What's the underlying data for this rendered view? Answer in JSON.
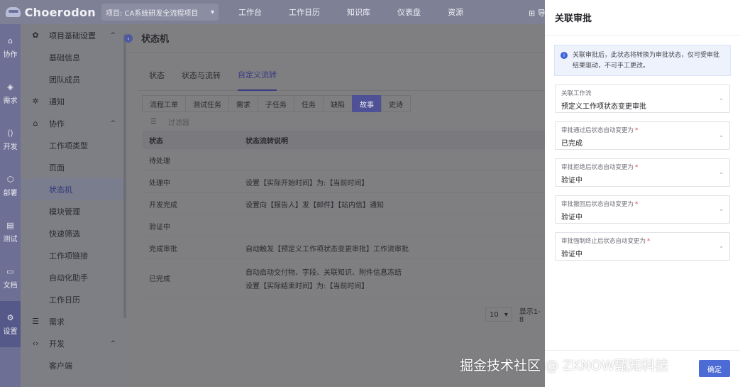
{
  "app": {
    "logo_text": "Choerodon"
  },
  "project": {
    "label": "项目: CA系统研发全流程项目",
    "chevron_icon": "chevron-down-icon"
  },
  "top_nav": [
    "工作台",
    "工作日历",
    "知识库",
    "仪表盘",
    "资源"
  ],
  "top_right_text": "⊞ 导",
  "rail": [
    {
      "label": "协作",
      "icon": "collab-icon",
      "glyph": "⌂"
    },
    {
      "label": "需求",
      "icon": "requirement-icon",
      "glyph": "◈"
    },
    {
      "label": "开发",
      "icon": "code-icon",
      "glyph": "⟨⟩"
    },
    {
      "label": "部署",
      "icon": "deploy-icon",
      "glyph": "⬡"
    },
    {
      "label": "测试",
      "icon": "test-icon",
      "glyph": "▤"
    },
    {
      "label": "文档",
      "icon": "doc-icon",
      "glyph": "▭"
    },
    {
      "label": "设置",
      "icon": "settings-icon",
      "glyph": "⚙"
    }
  ],
  "menu": {
    "group_basic": "项目基础设置",
    "basic_items": [
      "基础信息",
      "团队成员"
    ],
    "group_notify": "通知",
    "group_collab": "协作",
    "collab_items": [
      "工作项类型",
      "页面",
      "状态机",
      "模块管理",
      "快速筛选",
      "工作项链接",
      "自动化助手",
      "工作日历"
    ],
    "group_req": "需求",
    "group_dev": "开发",
    "dev_items": [
      "客户端"
    ]
  },
  "page": {
    "title": "状态机"
  },
  "tabs": [
    "状态",
    "状态与流转",
    "自定义流转"
  ],
  "chips": [
    "流程工单",
    "测试任务",
    "需求",
    "子任务",
    "任务",
    "缺陷",
    "故事",
    "史诗"
  ],
  "filter": {
    "placeholder": "过滤器"
  },
  "table": {
    "headers": [
      "状态",
      "状态流转说明"
    ],
    "rows": [
      {
        "status": "待处理",
        "desc": []
      },
      {
        "status": "处理中",
        "desc": [
          "设置【实际开始时间】为:【当前时间】"
        ]
      },
      {
        "status": "开发完成",
        "desc": [
          "设置向【报告人】发【邮件】【站内信】通知"
        ]
      },
      {
        "status": "验证中",
        "desc": []
      },
      {
        "status": "完成审批",
        "desc": [
          "自动触发【预定义工作项状态变更审批】工作流审批"
        ]
      },
      {
        "status": "已完成",
        "desc": [
          "自动启动交付物、字段、关联知识、附件信息冻结",
          "设置【实际结束时间】为:【当前时间】"
        ]
      }
    ]
  },
  "pager": {
    "size": "10",
    "text": "显示1-8"
  },
  "drawer": {
    "title": "关联审批",
    "notice": "关联审批后，此状态将转换为审批状态，仅可受审批结果驱动，不可手工更改。",
    "fields": [
      {
        "label": "关联工作流",
        "required": "",
        "value": "预定义工作项状态变更审批"
      },
      {
        "label": "审批通过后状态自动变更为",
        "required": "*",
        "value": "已完成"
      },
      {
        "label": "审批拒绝后状态自动变更为",
        "required": "*",
        "value": "验证中"
      },
      {
        "label": "审批撤回后状态自动变更为",
        "required": "*",
        "value": "验证中"
      },
      {
        "label": "审批强制终止后状态自动变更为",
        "required": "*",
        "value": "验证中"
      }
    ],
    "ok_label": "确定"
  },
  "watermark": "掘金技术社区 @ ZKNOW甄知科技"
}
